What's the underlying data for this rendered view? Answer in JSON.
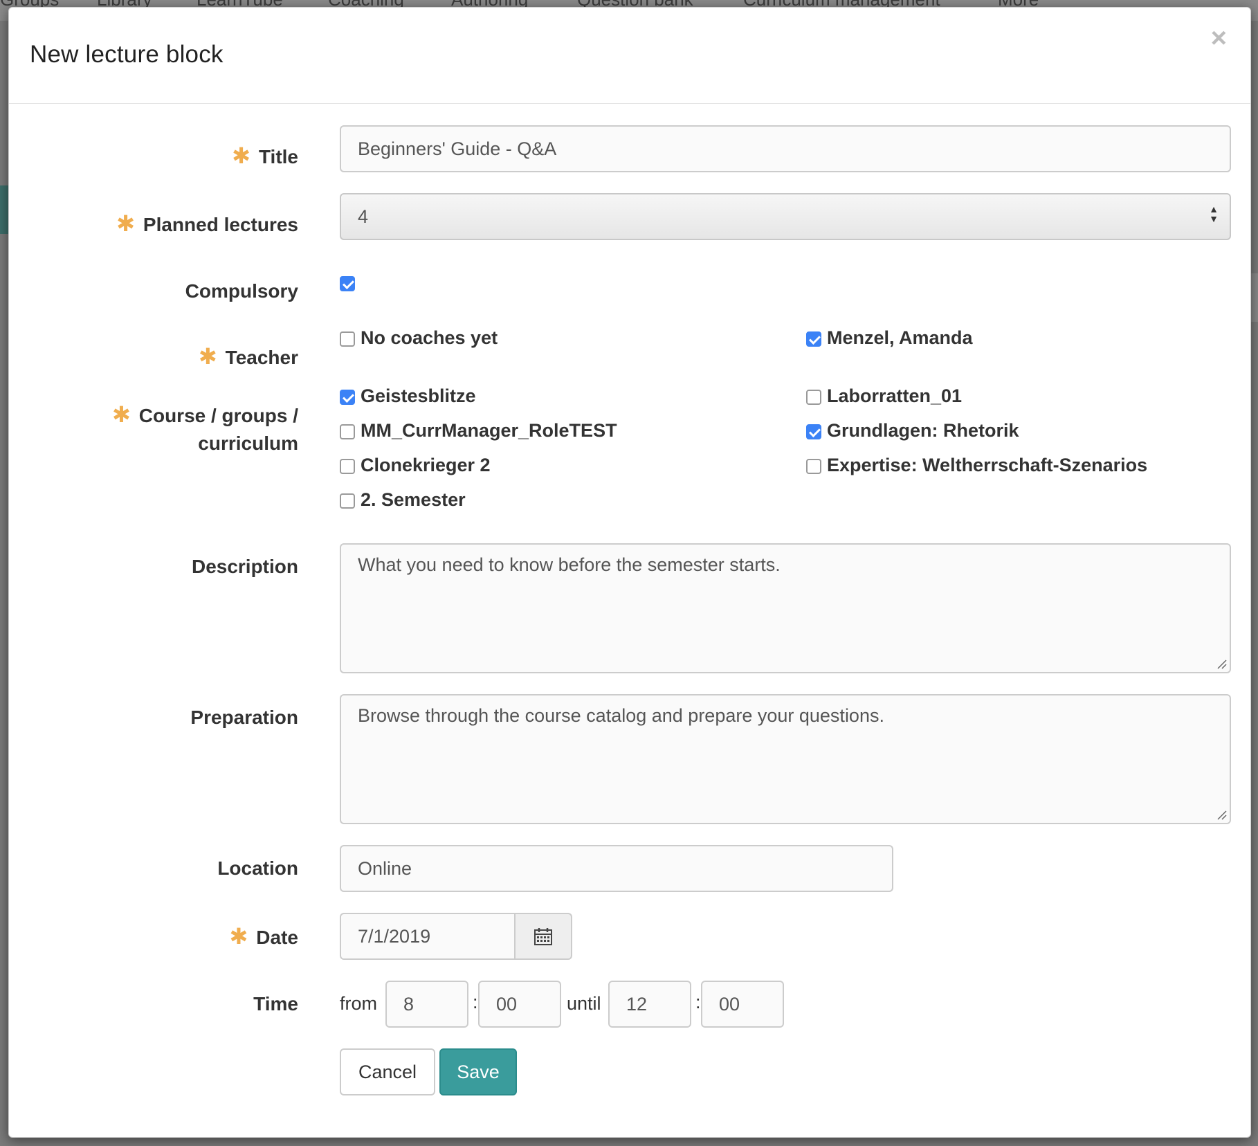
{
  "background": {
    "nav_items": [
      "Groups",
      "Library",
      "LearnTube",
      "Coaching",
      "Authoring",
      "Question bank",
      "Curriculum management",
      "More"
    ]
  },
  "modal": {
    "title": "New lecture block",
    "close_symbol": "×"
  },
  "form": {
    "title": {
      "label": "Title",
      "value": "Beginners' Guide - Q&A",
      "required": true
    },
    "planned_lectures": {
      "label": "Planned lectures",
      "value": "4",
      "required": true
    },
    "compulsory": {
      "label": "Compulsory",
      "checked": true
    },
    "teacher": {
      "label": "Teacher",
      "required": true,
      "options": [
        {
          "label": "No coaches yet",
          "checked": false
        },
        {
          "label": "Menzel, Amanda",
          "checked": true
        }
      ]
    },
    "course_groups": {
      "label_line1": "Course / groups /",
      "label_line2": "curriculum",
      "required": true,
      "options": [
        {
          "label": "Geistesblitze",
          "checked": true
        },
        {
          "label": "Laborratten_01",
          "checked": false
        },
        {
          "label": "MM_CurrManager_RoleTEST",
          "checked": false
        },
        {
          "label": "Grundlagen: Rhetorik",
          "checked": true
        },
        {
          "label": "Clonekrieger 2",
          "checked": false
        },
        {
          "label": "Expertise: Weltherrschaft-Szenarios",
          "checked": false
        },
        {
          "label": "2. Semester",
          "checked": false
        }
      ]
    },
    "description": {
      "label": "Description",
      "value": "What you need to know before the semester starts."
    },
    "preparation": {
      "label": "Preparation",
      "value": "Browse through the course catalog and prepare your questions."
    },
    "location": {
      "label": "Location",
      "value": "Online"
    },
    "date": {
      "label": "Date",
      "value": "7/1/2019",
      "required": true,
      "icon": "calendar-icon"
    },
    "time": {
      "label": "Time",
      "from_label": "from",
      "until_label": "until",
      "separator": ":",
      "from_hour": "8",
      "from_minute": "00",
      "until_hour": "12",
      "until_minute": "00"
    },
    "buttons": {
      "cancel": "Cancel",
      "save": "Save"
    }
  },
  "colors": {
    "required_asterisk": "#f0ad4e",
    "checkbox_checked": "#3b82f6",
    "primary_button": "#3a9c9c"
  }
}
